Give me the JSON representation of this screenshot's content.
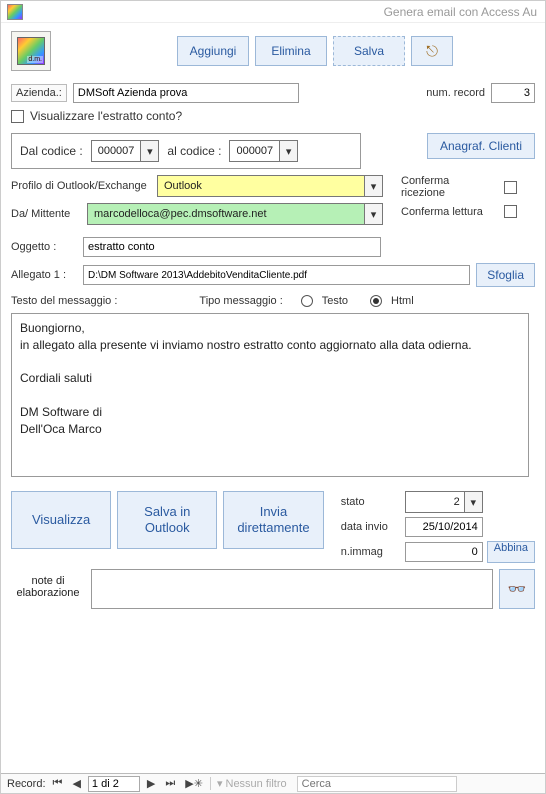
{
  "window": {
    "title": "Genera email con Access Au"
  },
  "toolbar": {
    "aggiungi": "Aggiungi",
    "elimina": "Elimina",
    "salva": "Salva"
  },
  "azienda": {
    "label": "Azienda.:",
    "value": "DMSoft Azienda prova",
    "num_record_label": "num. record",
    "num_record_value": "3"
  },
  "estratto": {
    "label": "Visualizzare l'estratto conto?"
  },
  "codici": {
    "dal_label": "Dal codice :",
    "dal_value": "000007",
    "al_label": "al codice :",
    "al_value": "000007"
  },
  "anagraf_btn": "Anagraf. Clienti",
  "conferma": {
    "ricezione": "Conferma ricezione",
    "lettura": "Conferma lettura"
  },
  "profilo": {
    "label": "Profilo di Outlook/Exchange",
    "value": "Outlook"
  },
  "mittente": {
    "label": "Da/ Mittente",
    "value": "marcodelloca@pec.dmsoftware.net"
  },
  "oggetto": {
    "label": "Oggetto :",
    "value": "estratto conto"
  },
  "allegato": {
    "label": "Allegato 1 :",
    "value": "D:\\DM Software 2013\\AddebitoVenditaCliente.pdf",
    "sfoglia": "Sfoglia"
  },
  "messaggio": {
    "testo_label": "Testo del messaggio :",
    "tipo_label": "Tipo messaggio :",
    "opt_testo": "Testo",
    "opt_html": "Html",
    "body": "Buongiorno,\nin allegato alla presente vi inviamo nostro estratto conto aggiornato alla data odierna.\n\nCordiali saluti\n\nDM Software di\nDell'Oca Marco"
  },
  "actions": {
    "visualizza": "Visualizza",
    "salva_outlook": "Salva in\nOutlook",
    "invia": "Invia\ndirettamente"
  },
  "status": {
    "stato_label": "stato",
    "stato_value": "2",
    "data_label": "data invio",
    "data_value": "25/10/2014",
    "nimmag_label": "n.immag",
    "nimmag_value": "0",
    "abbina": "Abbina"
  },
  "notes": {
    "label": "note di\nelaborazione"
  },
  "nav": {
    "record_label": "Record:",
    "pos": "1 di 2",
    "nofilter": "Nessun filtro",
    "search_placeholder": "Cerca"
  }
}
